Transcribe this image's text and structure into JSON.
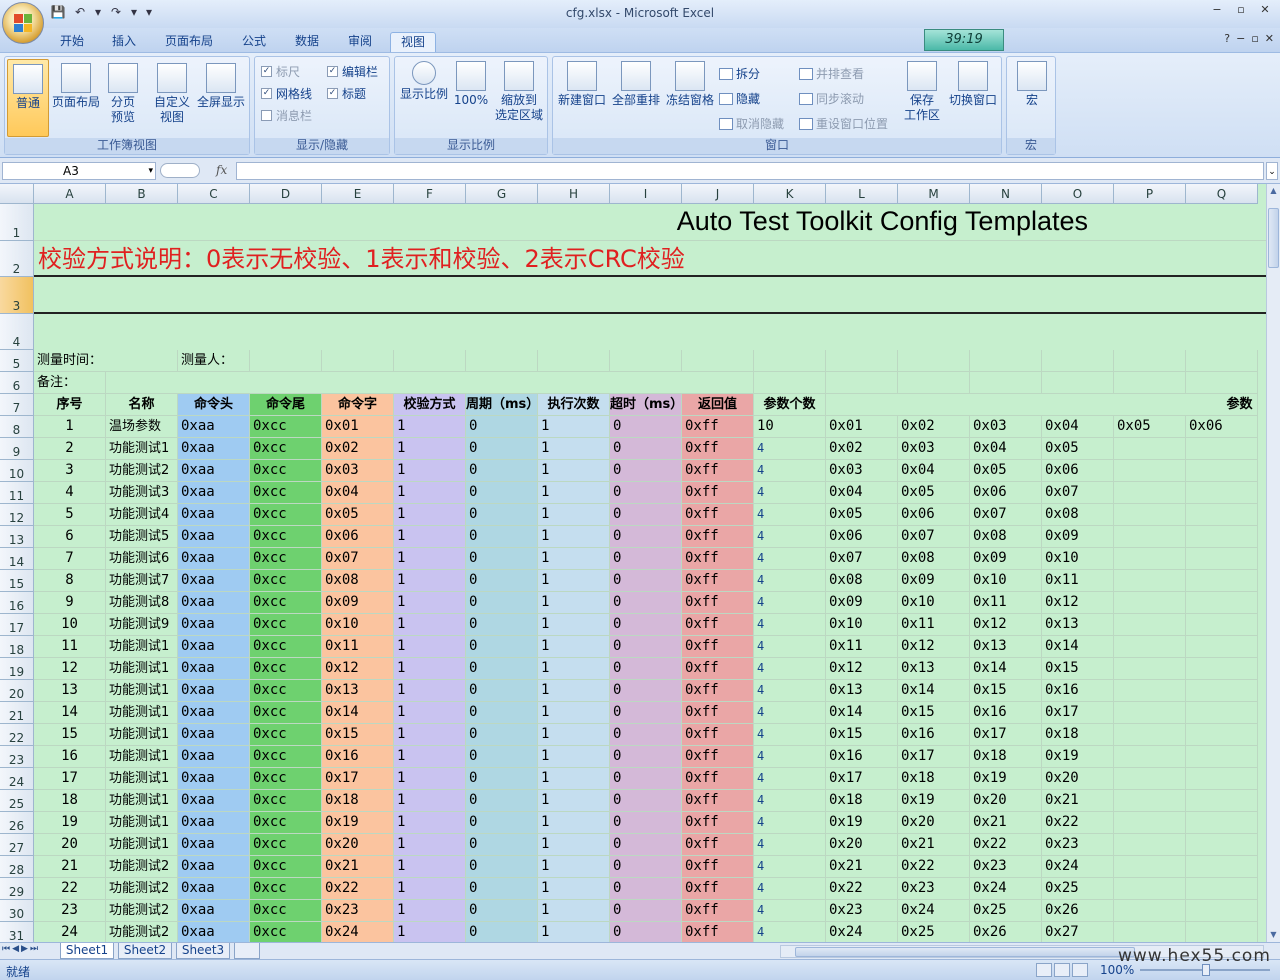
{
  "window": {
    "title": "cfg.xlsx - Microsoft Excel",
    "controls": [
      "−",
      "▫",
      "✕"
    ],
    "inner_controls": [
      "?",
      "−",
      "▫",
      "✕"
    ],
    "timer": "39:19"
  },
  "qat": {
    "save": "💾",
    "undo": "↶",
    "undo_dd": "▾",
    "redo": "↷",
    "redo_dd": "▾",
    "customize": "▾"
  },
  "tabs": [
    "开始",
    "插入",
    "页面布局",
    "公式",
    "数据",
    "审阅",
    "视图"
  ],
  "ribbon": {
    "workbook_views": {
      "label": "工作簿视图",
      "normal": "普通",
      "page_layout": "页面布局",
      "page_break_1": "分页",
      "page_break_2": "预览",
      "custom_1": "自定义",
      "custom_2": "视图",
      "fullscreen": "全屏显示"
    },
    "show_hide": {
      "label": "显示/隐藏",
      "ruler": "标尺",
      "formula_bar": "编辑栏",
      "gridlines": "网格线",
      "headings": "标题",
      "message_bar": "消息栏"
    },
    "zoom": {
      "label": "显示比例",
      "zoom": "显示比例",
      "zoom100": "100%",
      "zoom_sel_1": "缩放到",
      "zoom_sel_2": "选定区域"
    },
    "window": {
      "label": "窗口",
      "new_window": "新建窗口",
      "arrange_all": "全部重排",
      "freeze": "冻结窗格",
      "split": "拆分",
      "hide": "隐藏",
      "unhide": "取消隐藏",
      "side_by_side": "并排查看",
      "sync_scroll": "同步滚动",
      "reset_pos": "重设窗口位置",
      "save_ws_1": "保存",
      "save_ws_2": "工作区",
      "switch": "切换窗口"
    },
    "macros": {
      "label": "宏",
      "macros": "宏"
    }
  },
  "formula_bar": {
    "name_box": "A3",
    "fx": "fx",
    "dropdown": "▾",
    "expand": "⌄"
  },
  "columns": [
    "A",
    "B",
    "C",
    "D",
    "E",
    "F",
    "G",
    "H",
    "I",
    "J",
    "K",
    "L",
    "M",
    "N",
    "O",
    "P",
    "Q"
  ],
  "rows": [
    "1",
    "2",
    "3",
    "4",
    "5",
    "6",
    "7",
    "8",
    "9",
    "10",
    "11",
    "12",
    "13",
    "14",
    "15",
    "16",
    "17",
    "18",
    "19",
    "20",
    "21",
    "22",
    "23",
    "24",
    "25",
    "26",
    "27",
    "28",
    "29",
    "30",
    "31"
  ],
  "sheet": {
    "title": "Auto Test Toolkit Config Templates",
    "note": "校验方式说明：0表示无校验、1表示和校验、2表示CRC校验",
    "measure_time": "测量时间：",
    "measurer": "测量人：",
    "remark": "备注：",
    "headers": [
      "序号",
      "名称",
      "命令头",
      "命令尾",
      "命令字",
      "校验方式",
      "周期（ms）",
      "执行次数",
      "超时（ms）",
      "返回值",
      "参数个数"
    ],
    "param_header": "参数",
    "rows": [
      [
        "1",
        "温场参数",
        "0xaa",
        "0xcc",
        "0x01",
        "1",
        "0",
        "1",
        "0",
        "0xff",
        "10",
        "0x01",
        "0x02",
        "0x03",
        "0x04",
        "0x05",
        "0x06"
      ],
      [
        "2",
        "功能测试1",
        "0xaa",
        "0xcc",
        "0x02",
        "1",
        "0",
        "1",
        "0",
        "0xff",
        "4",
        "0x02",
        "0x03",
        "0x04",
        "0x05",
        "",
        ""
      ],
      [
        "3",
        "功能测试2",
        "0xaa",
        "0xcc",
        "0x03",
        "1",
        "0",
        "1",
        "0",
        "0xff",
        "4",
        "0x03",
        "0x04",
        "0x05",
        "0x06",
        "",
        ""
      ],
      [
        "4",
        "功能测试3",
        "0xaa",
        "0xcc",
        "0x04",
        "1",
        "0",
        "1",
        "0",
        "0xff",
        "4",
        "0x04",
        "0x05",
        "0x06",
        "0x07",
        "",
        ""
      ],
      [
        "5",
        "功能测试4",
        "0xaa",
        "0xcc",
        "0x05",
        "1",
        "0",
        "1",
        "0",
        "0xff",
        "4",
        "0x05",
        "0x06",
        "0x07",
        "0x08",
        "",
        ""
      ],
      [
        "6",
        "功能测试5",
        "0xaa",
        "0xcc",
        "0x06",
        "1",
        "0",
        "1",
        "0",
        "0xff",
        "4",
        "0x06",
        "0x07",
        "0x08",
        "0x09",
        "",
        ""
      ],
      [
        "7",
        "功能测试6",
        "0xaa",
        "0xcc",
        "0x07",
        "1",
        "0",
        "1",
        "0",
        "0xff",
        "4",
        "0x07",
        "0x08",
        "0x09",
        "0x10",
        "",
        ""
      ],
      [
        "8",
        "功能测试7",
        "0xaa",
        "0xcc",
        "0x08",
        "1",
        "0",
        "1",
        "0",
        "0xff",
        "4",
        "0x08",
        "0x09",
        "0x10",
        "0x11",
        "",
        ""
      ],
      [
        "9",
        "功能测试8",
        "0xaa",
        "0xcc",
        "0x09",
        "1",
        "0",
        "1",
        "0",
        "0xff",
        "4",
        "0x09",
        "0x10",
        "0x11",
        "0x12",
        "",
        ""
      ],
      [
        "10",
        "功能测试9",
        "0xaa",
        "0xcc",
        "0x10",
        "1",
        "0",
        "1",
        "0",
        "0xff",
        "4",
        "0x10",
        "0x11",
        "0x12",
        "0x13",
        "",
        ""
      ],
      [
        "11",
        "功能测试1",
        "0xaa",
        "0xcc",
        "0x11",
        "1",
        "0",
        "1",
        "0",
        "0xff",
        "4",
        "0x11",
        "0x12",
        "0x13",
        "0x14",
        "",
        ""
      ],
      [
        "12",
        "功能测试1",
        "0xaa",
        "0xcc",
        "0x12",
        "1",
        "0",
        "1",
        "0",
        "0xff",
        "4",
        "0x12",
        "0x13",
        "0x14",
        "0x15",
        "",
        ""
      ],
      [
        "13",
        "功能测试1",
        "0xaa",
        "0xcc",
        "0x13",
        "1",
        "0",
        "1",
        "0",
        "0xff",
        "4",
        "0x13",
        "0x14",
        "0x15",
        "0x16",
        "",
        ""
      ],
      [
        "14",
        "功能测试1",
        "0xaa",
        "0xcc",
        "0x14",
        "1",
        "0",
        "1",
        "0",
        "0xff",
        "4",
        "0x14",
        "0x15",
        "0x16",
        "0x17",
        "",
        ""
      ],
      [
        "15",
        "功能测试1",
        "0xaa",
        "0xcc",
        "0x15",
        "1",
        "0",
        "1",
        "0",
        "0xff",
        "4",
        "0x15",
        "0x16",
        "0x17",
        "0x18",
        "",
        ""
      ],
      [
        "16",
        "功能测试1",
        "0xaa",
        "0xcc",
        "0x16",
        "1",
        "0",
        "1",
        "0",
        "0xff",
        "4",
        "0x16",
        "0x17",
        "0x18",
        "0x19",
        "",
        ""
      ],
      [
        "17",
        "功能测试1",
        "0xaa",
        "0xcc",
        "0x17",
        "1",
        "0",
        "1",
        "0",
        "0xff",
        "4",
        "0x17",
        "0x18",
        "0x19",
        "0x20",
        "",
        ""
      ],
      [
        "18",
        "功能测试1",
        "0xaa",
        "0xcc",
        "0x18",
        "1",
        "0",
        "1",
        "0",
        "0xff",
        "4",
        "0x18",
        "0x19",
        "0x20",
        "0x21",
        "",
        ""
      ],
      [
        "19",
        "功能测试1",
        "0xaa",
        "0xcc",
        "0x19",
        "1",
        "0",
        "1",
        "0",
        "0xff",
        "4",
        "0x19",
        "0x20",
        "0x21",
        "0x22",
        "",
        ""
      ],
      [
        "20",
        "功能测试1",
        "0xaa",
        "0xcc",
        "0x20",
        "1",
        "0",
        "1",
        "0",
        "0xff",
        "4",
        "0x20",
        "0x21",
        "0x22",
        "0x23",
        "",
        ""
      ],
      [
        "21",
        "功能测试2",
        "0xaa",
        "0xcc",
        "0x21",
        "1",
        "0",
        "1",
        "0",
        "0xff",
        "4",
        "0x21",
        "0x22",
        "0x23",
        "0x24",
        "",
        ""
      ],
      [
        "22",
        "功能测试2",
        "0xaa",
        "0xcc",
        "0x22",
        "1",
        "0",
        "1",
        "0",
        "0xff",
        "4",
        "0x22",
        "0x23",
        "0x24",
        "0x25",
        "",
        ""
      ],
      [
        "23",
        "功能测试2",
        "0xaa",
        "0xcc",
        "0x23",
        "1",
        "0",
        "1",
        "0",
        "0xff",
        "4",
        "0x23",
        "0x24",
        "0x25",
        "0x26",
        "",
        ""
      ],
      [
        "24",
        "功能测试2",
        "0xaa",
        "0xcc",
        "0x24",
        "1",
        "0",
        "1",
        "0",
        "0xff",
        "4",
        "0x24",
        "0x25",
        "0x26",
        "0x27",
        "",
        ""
      ]
    ]
  },
  "sheet_tabs": [
    "Sheet1",
    "Sheet2",
    "Sheet3"
  ],
  "sheet_nav": [
    "⏮",
    "◀",
    "▶",
    "⏭"
  ],
  "status": {
    "text": "就绪",
    "zoom": "100%"
  },
  "watermark": "www.hex55.com",
  "colors": {
    "col_C": "#9fcbf2",
    "col_D": "#6ed16f",
    "col_E": "#fbc49f",
    "col_F": "#c9c3f0",
    "col_G": "#afd7e3",
    "col_H": "#c5deef",
    "col_I": "#d4b9d8",
    "col_J": "#eaa6a6",
    "sheet_bg": "#c6efce",
    "note_red": "#e02020"
  }
}
